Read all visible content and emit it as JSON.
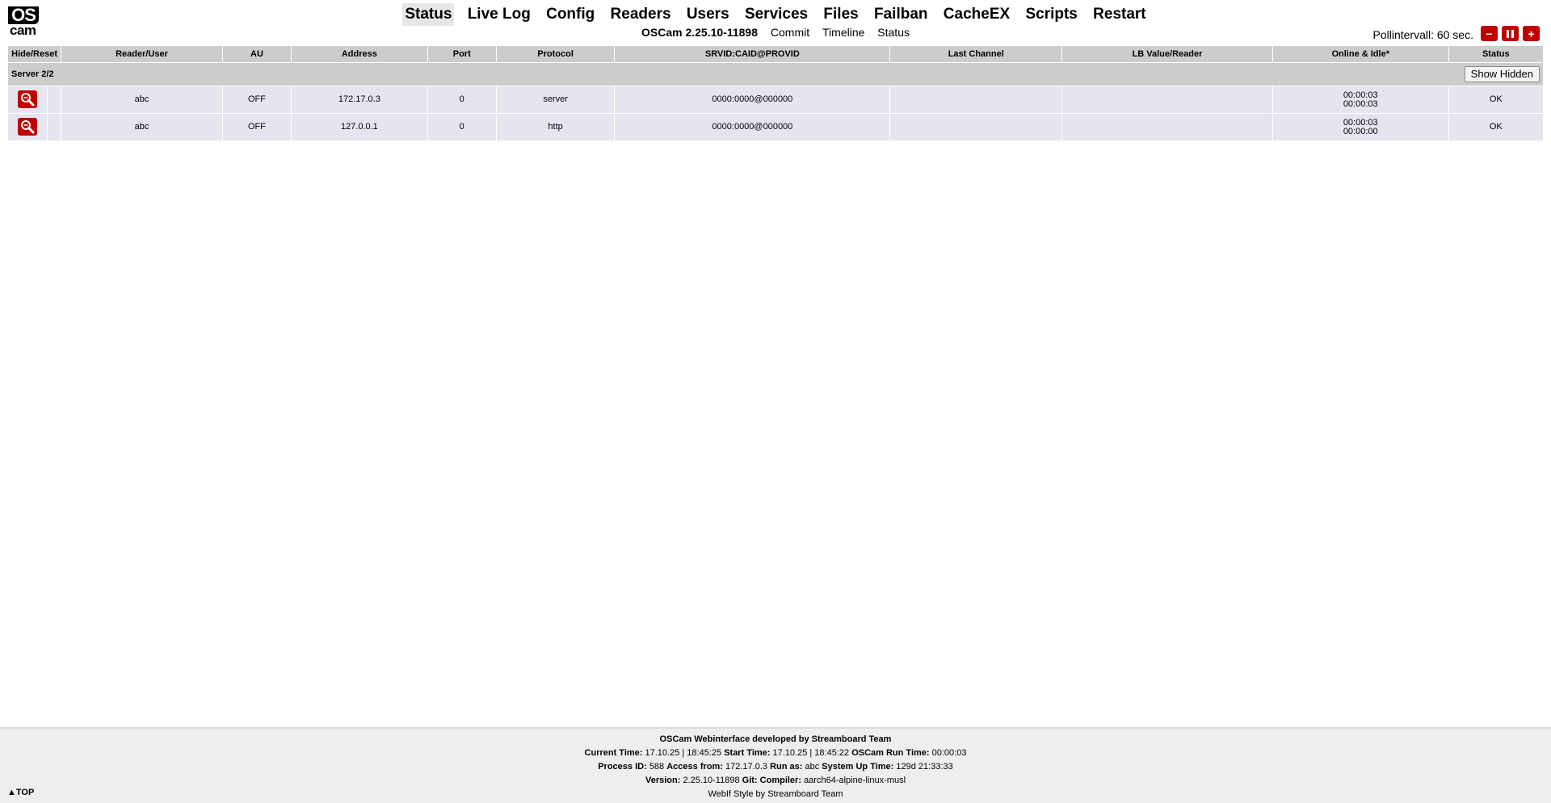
{
  "logo": {
    "line1": "OS",
    "line2": "cam"
  },
  "nav": {
    "items": [
      "Status",
      "Live Log",
      "Config",
      "Readers",
      "Users",
      "Services",
      "Files",
      "Failban",
      "CacheEX",
      "Scripts",
      "Restart"
    ],
    "active": "Status"
  },
  "subnav": {
    "version": "OSCam 2.25.10-11898",
    "links": [
      "Commit",
      "Timeline",
      "Status"
    ]
  },
  "poll": {
    "label": "Pollintervall: 60 sec.",
    "minus": "−",
    "plus": "+"
  },
  "table": {
    "headers": [
      "Hide/Reset",
      "Reader/User",
      "AU",
      "Address",
      "Port",
      "Protocol",
      "SRVID:CAID@PROVID",
      "Last Channel",
      "LB Value/Reader",
      "Online & Idle*",
      "Status"
    ],
    "group_label": "Server 2/2",
    "show_hidden_label": "Show Hidden",
    "rows": [
      {
        "name": "abc",
        "au": "OFF",
        "address": "172.17.0.3",
        "port": "0",
        "protocol": "server",
        "srvid": "0000:0000@000000",
        "last_channel": "",
        "lb_value": "",
        "online": "00:00:03",
        "idle": "00:00:03",
        "status": "OK"
      },
      {
        "name": "abc",
        "au": "OFF",
        "address": "127.0.0.1",
        "port": "0",
        "protocol": "http",
        "srvid": "0000:0000@000000",
        "last_channel": "",
        "lb_value": "",
        "online": "00:00:03",
        "idle": "00:00:00",
        "status": "OK"
      }
    ]
  },
  "footer": {
    "title": "OSCam Webinterface developed by Streamboard Team",
    "current_time_label": "Current Time:",
    "current_time": "17.10.25 | 18:45:25",
    "start_time_label": "Start Time:",
    "start_time": "17.10.25 | 18:45:22",
    "run_time_label": "OSCam Run Time:",
    "run_time": "00:00:03",
    "pid_label": "Process ID:",
    "pid": "588",
    "access_label": "Access from:",
    "access": "172.17.0.3",
    "runas_label": "Run as:",
    "runas": "abc",
    "uptime_label": "System Up Time:",
    "uptime": "129d 21:33:33",
    "version_label": "Version:",
    "version": "2.25.10-11898",
    "git_label": "Git:",
    "compiler_label": "Compiler:",
    "compiler": "aarch64-alpine-linux-musl",
    "style_credit": "WebIf Style by Streamboard Team",
    "top_link": "▲TOP"
  },
  "colors": {
    "accent_red": "#c00000",
    "header_gray": "#cccccc",
    "row_bg": "#e5e5f0"
  },
  "icons": {
    "row_action": "magnifier-icon",
    "pause": "pause-icon"
  }
}
